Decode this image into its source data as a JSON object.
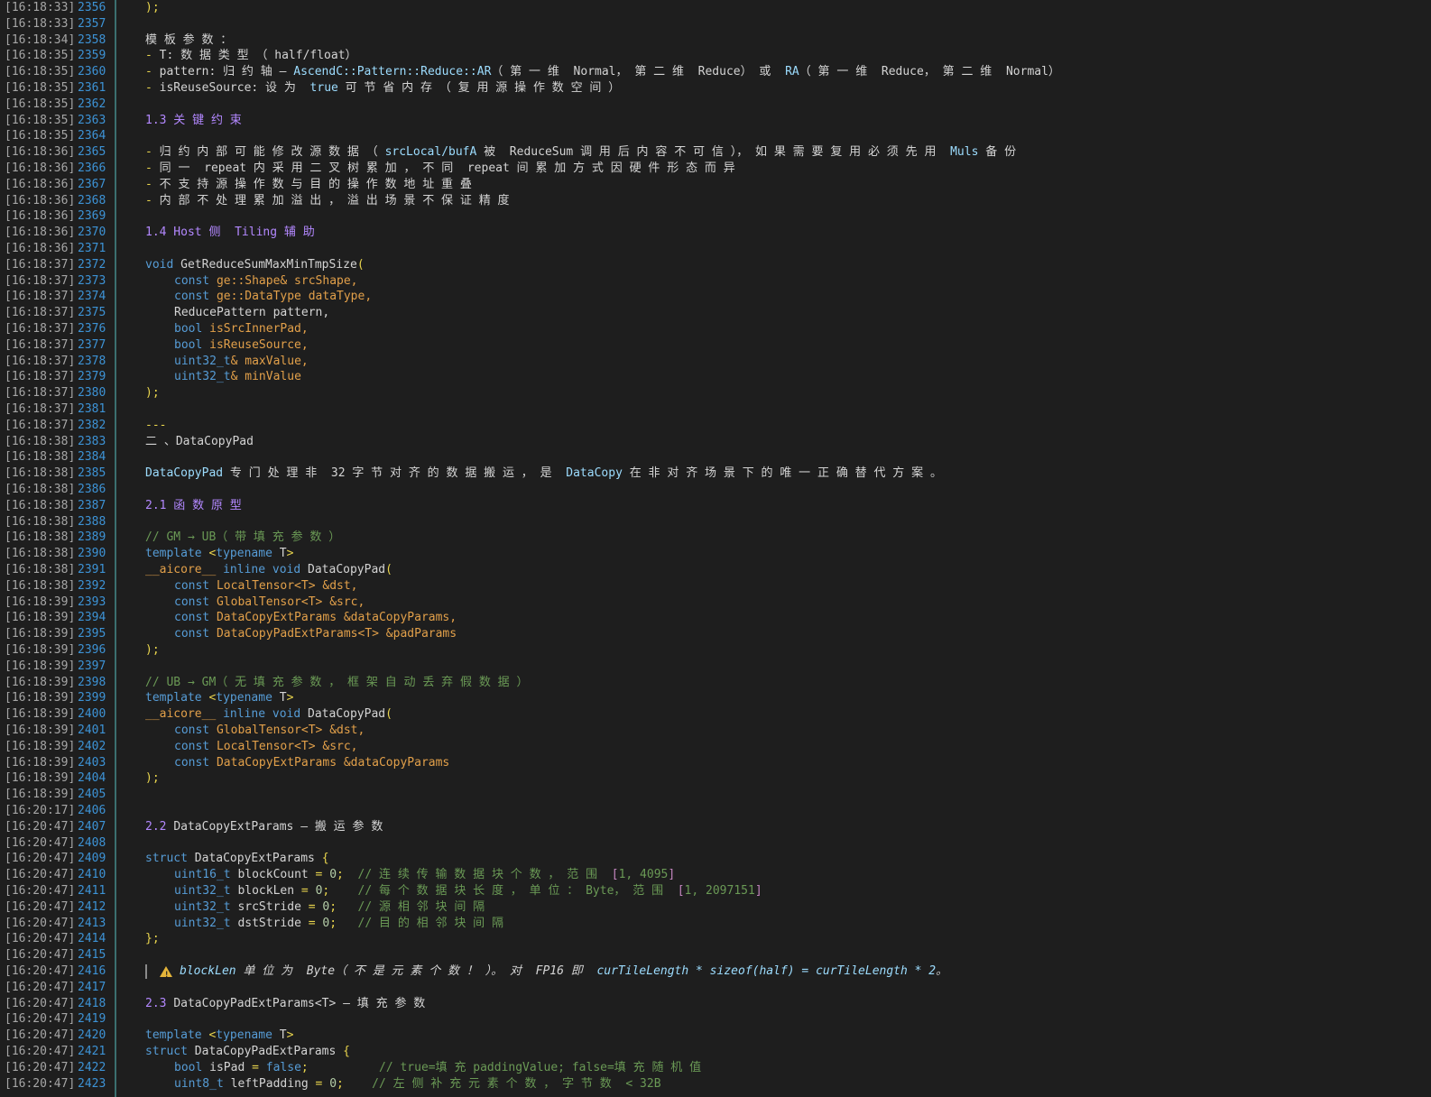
{
  "colors": {
    "background": "#1e1e1e",
    "timestamp": "#a6a6a6",
    "line_number": "#3d93d6",
    "text": "#d4d4d4",
    "heading": "#b388ff",
    "keyword": "#569cd6",
    "type": "#4ec9b0",
    "param": "#e2a04a",
    "yellow_punct": "#e8d44d",
    "comment": "#6a9955",
    "number": "#b5cea8",
    "bracket": "#c586c0"
  },
  "lines": [
    {
      "ts": "[16:18:33]",
      "ln": "2356",
      "segs": [
        {
          "t": ");",
          "c": "#e8d44d"
        }
      ]
    },
    {
      "ts": "[16:18:33]",
      "ln": "2357",
      "segs": []
    },
    {
      "ts": "[16:18:34]",
      "ln": "2358",
      "segs": [
        {
          "t": "模 板 参 数 ：",
          "c": "#d4d4d4"
        }
      ]
    },
    {
      "ts": "[16:18:35]",
      "ln": "2359",
      "segs": [
        {
          "t": "- ",
          "c": "#e8d44d"
        },
        {
          "t": "T",
          "c": "#d4d4d4"
        },
        {
          "t": ": 数 据 类 型 （ half/float）",
          "c": "#d4d4d4"
        }
      ]
    },
    {
      "ts": "[16:18:35]",
      "ln": "2360",
      "segs": [
        {
          "t": "- ",
          "c": "#e8d44d"
        },
        {
          "t": "pattern",
          "c": "#d4d4d4"
        },
        {
          "t": ": 归 约 轴 — ",
          "c": "#d4d4d4"
        },
        {
          "t": "AscendC::Pattern::Reduce::AR",
          "c": "#9cdcfe"
        },
        {
          "t": "（ 第 一 维  Normal， 第 二 维  Reduce） 或  ",
          "c": "#d4d4d4"
        },
        {
          "t": "RA",
          "c": "#9cdcfe"
        },
        {
          "t": "（ 第 一 维  Reduce， 第 二 维  Normal）",
          "c": "#d4d4d4"
        }
      ]
    },
    {
      "ts": "[16:18:35]",
      "ln": "2361",
      "segs": [
        {
          "t": "- ",
          "c": "#e8d44d"
        },
        {
          "t": "isReuseSource",
          "c": "#d4d4d4"
        },
        {
          "t": ": 设 为  ",
          "c": "#d4d4d4"
        },
        {
          "t": "true",
          "c": "#9cdcfe"
        },
        {
          "t": " 可 节 省 内 存 （ 复 用 源 操 作 数 空 间 ）",
          "c": "#d4d4d4"
        }
      ]
    },
    {
      "ts": "[16:18:35]",
      "ln": "2362",
      "segs": []
    },
    {
      "ts": "[16:18:35]",
      "ln": "2363",
      "segs": [
        {
          "t": "1.3 关 键 约 束",
          "c": "#b388ff"
        }
      ]
    },
    {
      "ts": "[16:18:35]",
      "ln": "2364",
      "segs": []
    },
    {
      "ts": "[16:18:36]",
      "ln": "2365",
      "segs": [
        {
          "t": "- ",
          "c": "#e8d44d"
        },
        {
          "t": "归 约 内 部 可 能 修 改 源 数 据 （ ",
          "c": "#d4d4d4"
        },
        {
          "t": "srcLocal/bufA",
          "c": "#9cdcfe"
        },
        {
          "t": " 被  ReduceSum 调 用 后 内 容 不 可 信 ）， 如 果 需 要 复 用 必 须 先 用  ",
          "c": "#d4d4d4"
        },
        {
          "t": "Muls",
          "c": "#9cdcfe"
        },
        {
          "t": " 备 份",
          "c": "#d4d4d4"
        }
      ]
    },
    {
      "ts": "[16:18:36]",
      "ln": "2366",
      "segs": [
        {
          "t": "- ",
          "c": "#e8d44d"
        },
        {
          "t": "同 一  repeat 内 采 用 二 叉 树 累 加 ， 不 同  repeat 间 累 加 方 式 因 硬 件 形 态 而 异",
          "c": "#d4d4d4"
        }
      ]
    },
    {
      "ts": "[16:18:36]",
      "ln": "2367",
      "segs": [
        {
          "t": "- ",
          "c": "#e8d44d"
        },
        {
          "t": "不 支 持 源 操 作 数 与 目 的 操 作 数 地 址 重 叠",
          "c": "#d4d4d4"
        }
      ]
    },
    {
      "ts": "[16:18:36]",
      "ln": "2368",
      "segs": [
        {
          "t": "- ",
          "c": "#e8d44d"
        },
        {
          "t": "内 部 不 处 理 累 加 溢 出 ， 溢 出 场 景 不 保 证 精 度",
          "c": "#d4d4d4"
        }
      ]
    },
    {
      "ts": "[16:18:36]",
      "ln": "2369",
      "segs": []
    },
    {
      "ts": "[16:18:36]",
      "ln": "2370",
      "segs": [
        {
          "t": "1.4 Host 侧  Tiling 辅 助",
          "c": "#b388ff"
        }
      ]
    },
    {
      "ts": "[16:18:36]",
      "ln": "2371",
      "segs": []
    },
    {
      "ts": "[16:18:37]",
      "ln": "2372",
      "segs": [
        {
          "t": "void ",
          "c": "#569cd6"
        },
        {
          "t": "GetReduceSumMaxMinTmpSize",
          "c": "#d4d4d4"
        },
        {
          "t": "(",
          "c": "#e8d44d"
        }
      ]
    },
    {
      "ts": "[16:18:37]",
      "ln": "2373",
      "ind": 1,
      "segs": [
        {
          "t": "const ",
          "c": "#569cd6"
        },
        {
          "t": "ge::Shape& srcShape,",
          "c": "#e2a04a"
        }
      ]
    },
    {
      "ts": "[16:18:37]",
      "ln": "2374",
      "ind": 1,
      "segs": [
        {
          "t": "const ",
          "c": "#569cd6"
        },
        {
          "t": "ge::DataType dataType,",
          "c": "#e2a04a"
        }
      ]
    },
    {
      "ts": "[16:18:37]",
      "ln": "2375",
      "ind": 1,
      "segs": [
        {
          "t": "ReducePattern pattern,",
          "c": "#d4d4d4"
        }
      ]
    },
    {
      "ts": "[16:18:37]",
      "ln": "2376",
      "ind": 1,
      "segs": [
        {
          "t": "bool ",
          "c": "#569cd6"
        },
        {
          "t": "isSrcInnerPad,",
          "c": "#e2a04a"
        }
      ]
    },
    {
      "ts": "[16:18:37]",
      "ln": "2377",
      "ind": 1,
      "segs": [
        {
          "t": "bool ",
          "c": "#569cd6"
        },
        {
          "t": "isReuseSource,",
          "c": "#e2a04a"
        }
      ]
    },
    {
      "ts": "[16:18:37]",
      "ln": "2378",
      "ind": 1,
      "segs": [
        {
          "t": "uint32_t",
          "c": "#569cd6"
        },
        {
          "t": "& maxValue,",
          "c": "#e2a04a"
        }
      ]
    },
    {
      "ts": "[16:18:37]",
      "ln": "2379",
      "ind": 1,
      "segs": [
        {
          "t": "uint32_t",
          "c": "#569cd6"
        },
        {
          "t": "& minValue",
          "c": "#e2a04a"
        }
      ]
    },
    {
      "ts": "[16:18:37]",
      "ln": "2380",
      "segs": [
        {
          "t": ");",
          "c": "#e8d44d"
        }
      ]
    },
    {
      "ts": "[16:18:37]",
      "ln": "2381",
      "segs": []
    },
    {
      "ts": "[16:18:37]",
      "ln": "2382",
      "segs": [
        {
          "t": "---",
          "c": "#e8d44d"
        }
      ]
    },
    {
      "ts": "[16:18:38]",
      "ln": "2383",
      "segs": [
        {
          "t": "二 、DataCopyPad",
          "c": "#d4d4d4"
        }
      ]
    },
    {
      "ts": "[16:18:38]",
      "ln": "2384",
      "segs": []
    },
    {
      "ts": "[16:18:38]",
      "ln": "2385",
      "segs": [
        {
          "t": "DataCopyPad",
          "c": "#9cdcfe"
        },
        {
          "t": " 专 门 处 理 非  32 字 节 对 齐 的 数 据 搬 运 ， 是  ",
          "c": "#d4d4d4"
        },
        {
          "t": "DataCopy",
          "c": "#9cdcfe"
        },
        {
          "t": " 在 非 对 齐 场 景 下 的 唯 一 正 确 替 代 方 案 。",
          "c": "#d4d4d4"
        }
      ]
    },
    {
      "ts": "[16:18:38]",
      "ln": "2386",
      "segs": []
    },
    {
      "ts": "[16:18:38]",
      "ln": "2387",
      "segs": [
        {
          "t": "2.1 函 数 原 型",
          "c": "#b388ff"
        }
      ]
    },
    {
      "ts": "[16:18:38]",
      "ln": "2388",
      "segs": []
    },
    {
      "ts": "[16:18:38]",
      "ln": "2389",
      "segs": [
        {
          "t": "// GM → UB（ 带 填 充 参 数 ）",
          "c": "#6a9955"
        }
      ]
    },
    {
      "ts": "[16:18:38]",
      "ln": "2390",
      "segs": [
        {
          "t": "template ",
          "c": "#569cd6"
        },
        {
          "t": "<",
          "c": "#e8d44d"
        },
        {
          "t": "typename ",
          "c": "#569cd6"
        },
        {
          "t": "T",
          "c": "#d4d4d4"
        },
        {
          "t": ">",
          "c": "#e8d44d"
        }
      ]
    },
    {
      "ts": "[16:18:38]",
      "ln": "2391",
      "segs": [
        {
          "t": "__aicore__ ",
          "c": "#e2a04a"
        },
        {
          "t": "inline void ",
          "c": "#569cd6"
        },
        {
          "t": "DataCopyPad",
          "c": "#d4d4d4"
        },
        {
          "t": "(",
          "c": "#e8d44d"
        }
      ]
    },
    {
      "ts": "[16:18:38]",
      "ln": "2392",
      "ind": 1,
      "segs": [
        {
          "t": "const ",
          "c": "#569cd6"
        },
        {
          "t": "LocalTensor<T> &dst,",
          "c": "#e2a04a"
        }
      ]
    },
    {
      "ts": "[16:18:39]",
      "ln": "2393",
      "ind": 1,
      "segs": [
        {
          "t": "const ",
          "c": "#569cd6"
        },
        {
          "t": "GlobalTensor<T> &src,",
          "c": "#e2a04a"
        }
      ]
    },
    {
      "ts": "[16:18:39]",
      "ln": "2394",
      "ind": 1,
      "segs": [
        {
          "t": "const ",
          "c": "#569cd6"
        },
        {
          "t": "DataCopyExtParams &dataCopyParams,",
          "c": "#e2a04a"
        }
      ]
    },
    {
      "ts": "[16:18:39]",
      "ln": "2395",
      "ind": 1,
      "segs": [
        {
          "t": "const ",
          "c": "#569cd6"
        },
        {
          "t": "DataCopyPadExtParams<T> &padParams",
          "c": "#e2a04a"
        }
      ]
    },
    {
      "ts": "[16:18:39]",
      "ln": "2396",
      "segs": [
        {
          "t": ");",
          "c": "#e8d44d"
        }
      ]
    },
    {
      "ts": "[16:18:39]",
      "ln": "2397",
      "segs": []
    },
    {
      "ts": "[16:18:39]",
      "ln": "2398",
      "segs": [
        {
          "t": "// UB → GM（ 无 填 充 参 数 ， 框 架 自 动 丢 弃 假 数 据 ）",
          "c": "#6a9955"
        }
      ]
    },
    {
      "ts": "[16:18:39]",
      "ln": "2399",
      "segs": [
        {
          "t": "template ",
          "c": "#569cd6"
        },
        {
          "t": "<",
          "c": "#e8d44d"
        },
        {
          "t": "typename ",
          "c": "#569cd6"
        },
        {
          "t": "T",
          "c": "#d4d4d4"
        },
        {
          "t": ">",
          "c": "#e8d44d"
        }
      ]
    },
    {
      "ts": "[16:18:39]",
      "ln": "2400",
      "segs": [
        {
          "t": "__aicore__ ",
          "c": "#e2a04a"
        },
        {
          "t": "inline void ",
          "c": "#569cd6"
        },
        {
          "t": "DataCopyPad",
          "c": "#d4d4d4"
        },
        {
          "t": "(",
          "c": "#e8d44d"
        }
      ]
    },
    {
      "ts": "[16:18:39]",
      "ln": "2401",
      "ind": 1,
      "segs": [
        {
          "t": "const ",
          "c": "#569cd6"
        },
        {
          "t": "GlobalTensor<T> &dst,",
          "c": "#e2a04a"
        }
      ]
    },
    {
      "ts": "[16:18:39]",
      "ln": "2402",
      "ind": 1,
      "segs": [
        {
          "t": "const ",
          "c": "#569cd6"
        },
        {
          "t": "LocalTensor<T> &src,",
          "c": "#e2a04a"
        }
      ]
    },
    {
      "ts": "[16:18:39]",
      "ln": "2403",
      "ind": 1,
      "segs": [
        {
          "t": "const ",
          "c": "#569cd6"
        },
        {
          "t": "DataCopyExtParams &dataCopyParams",
          "c": "#e2a04a"
        }
      ]
    },
    {
      "ts": "[16:18:39]",
      "ln": "2404",
      "segs": [
        {
          "t": ");",
          "c": "#e8d44d"
        }
      ]
    },
    {
      "ts": "[16:18:39]",
      "ln": "2405",
      "segs": []
    },
    {
      "ts": "[16:20:17]",
      "ln": "2406",
      "segs": []
    },
    {
      "ts": "[16:20:47]",
      "ln": "2407",
      "segs": [
        {
          "t": "2.2 ",
          "c": "#b388ff"
        },
        {
          "t": "DataCopyExtParams — 搬 运 参 数",
          "c": "#d4d4d4"
        }
      ]
    },
    {
      "ts": "[16:20:47]",
      "ln": "2408",
      "segs": []
    },
    {
      "ts": "[16:20:47]",
      "ln": "2409",
      "segs": [
        {
          "t": "struct ",
          "c": "#569cd6"
        },
        {
          "t": "DataCopyExtParams ",
          "c": "#d4d4d4"
        },
        {
          "t": "{",
          "c": "#e8d44d"
        }
      ]
    },
    {
      "ts": "[16:20:47]",
      "ln": "2410",
      "ind": 1,
      "segs": [
        {
          "t": "uint16_t ",
          "c": "#569cd6"
        },
        {
          "t": "blockCount ",
          "c": "#d4d4d4"
        },
        {
          "t": "= ",
          "c": "#e8d44d"
        },
        {
          "t": "0",
          "c": "#b5cea8"
        },
        {
          "t": ";  ",
          "c": "#e8d44d"
        },
        {
          "t": "// 连 续 传 输 数 据 块 个 数 ， 范 围  ",
          "c": "#6a9955"
        },
        {
          "t": "[",
          "c": "#c586c0"
        },
        {
          "t": "1, 4095",
          "c": "#6a9955"
        },
        {
          "t": "]",
          "c": "#c586c0"
        }
      ]
    },
    {
      "ts": "[16:20:47]",
      "ln": "2411",
      "ind": 1,
      "segs": [
        {
          "t": "uint32_t ",
          "c": "#569cd6"
        },
        {
          "t": "blockLen ",
          "c": "#d4d4d4"
        },
        {
          "t": "= ",
          "c": "#e8d44d"
        },
        {
          "t": "0",
          "c": "#b5cea8"
        },
        {
          "t": ";    ",
          "c": "#e8d44d"
        },
        {
          "t": "// 每 个 数 据 块 长 度 ， 单 位 ： Byte， 范 围  ",
          "c": "#6a9955"
        },
        {
          "t": "[",
          "c": "#c586c0"
        },
        {
          "t": "1, 2097151",
          "c": "#6a9955"
        },
        {
          "t": "]",
          "c": "#c586c0"
        }
      ]
    },
    {
      "ts": "[16:20:47]",
      "ln": "2412",
      "ind": 1,
      "segs": [
        {
          "t": "uint32_t ",
          "c": "#569cd6"
        },
        {
          "t": "srcStride ",
          "c": "#d4d4d4"
        },
        {
          "t": "= ",
          "c": "#e8d44d"
        },
        {
          "t": "0",
          "c": "#b5cea8"
        },
        {
          "t": ";   ",
          "c": "#e8d44d"
        },
        {
          "t": "// 源 相 邻 块 间 隔",
          "c": "#6a9955"
        }
      ]
    },
    {
      "ts": "[16:20:47]",
      "ln": "2413",
      "ind": 1,
      "segs": [
        {
          "t": "uint32_t ",
          "c": "#569cd6"
        },
        {
          "t": "dstStride ",
          "c": "#d4d4d4"
        },
        {
          "t": "= ",
          "c": "#e8d44d"
        },
        {
          "t": "0",
          "c": "#b5cea8"
        },
        {
          "t": ";   ",
          "c": "#e8d44d"
        },
        {
          "t": "// 目 的 相 邻 块 间 隔",
          "c": "#6a9955"
        }
      ]
    },
    {
      "ts": "[16:20:47]",
      "ln": "2414",
      "segs": [
        {
          "t": "};",
          "c": "#e8d44d"
        }
      ]
    },
    {
      "ts": "[16:20:47]",
      "ln": "2415",
      "segs": []
    },
    {
      "ts": "[16:20:47]",
      "ln": "2416",
      "quote": true,
      "segs": [
        {
          "t": "blockLen",
          "c": "#9cdcfe",
          "it": true
        },
        {
          "t": " 单 位 为  Byte（ 不 是 元 素 个 数 ！ ）。 对  FP16 即  ",
          "c": "#d4d4d4",
          "it": true
        },
        {
          "t": "curTileLength * sizeof(half) = curTileLength * 2",
          "c": "#9cdcfe",
          "it": true
        },
        {
          "t": "。",
          "c": "#d4d4d4",
          "it": true
        }
      ]
    },
    {
      "ts": "[16:20:47]",
      "ln": "2417",
      "segs": []
    },
    {
      "ts": "[16:20:47]",
      "ln": "2418",
      "segs": [
        {
          "t": "2.3 ",
          "c": "#b388ff"
        },
        {
          "t": "DataCopyPadExtParams<T> — 填 充 参 数",
          "c": "#d4d4d4"
        }
      ]
    },
    {
      "ts": "[16:20:47]",
      "ln": "2419",
      "segs": []
    },
    {
      "ts": "[16:20:47]",
      "ln": "2420",
      "segs": [
        {
          "t": "template ",
          "c": "#569cd6"
        },
        {
          "t": "<",
          "c": "#e8d44d"
        },
        {
          "t": "typename ",
          "c": "#569cd6"
        },
        {
          "t": "T",
          "c": "#d4d4d4"
        },
        {
          "t": ">",
          "c": "#e8d44d"
        }
      ]
    },
    {
      "ts": "[16:20:47]",
      "ln": "2421",
      "segs": [
        {
          "t": "struct ",
          "c": "#569cd6"
        },
        {
          "t": "DataCopyPadExtParams ",
          "c": "#d4d4d4"
        },
        {
          "t": "{",
          "c": "#e8d44d"
        }
      ]
    },
    {
      "ts": "[16:20:47]",
      "ln": "2422",
      "ind": 1,
      "segs": [
        {
          "t": "bool ",
          "c": "#569cd6"
        },
        {
          "t": "isPad ",
          "c": "#d4d4d4"
        },
        {
          "t": "= ",
          "c": "#e8d44d"
        },
        {
          "t": "false",
          "c": "#569cd6"
        },
        {
          "t": ";          ",
          "c": "#e8d44d"
        },
        {
          "t": "// true=填 充 paddingValue; false=填 充 随 机 值",
          "c": "#6a9955"
        }
      ]
    },
    {
      "ts": "[16:20:47]",
      "ln": "2423",
      "ind": 1,
      "segs": [
        {
          "t": "uint8_t ",
          "c": "#569cd6"
        },
        {
          "t": "leftPadding ",
          "c": "#d4d4d4"
        },
        {
          "t": "= ",
          "c": "#e8d44d"
        },
        {
          "t": "0",
          "c": "#b5cea8"
        },
        {
          "t": ";    ",
          "c": "#e8d44d"
        },
        {
          "t": "// 左 侧 补 充 元 素 个 数 ， 字 节 数  < 32B",
          "c": "#6a9955"
        }
      ]
    }
  ]
}
